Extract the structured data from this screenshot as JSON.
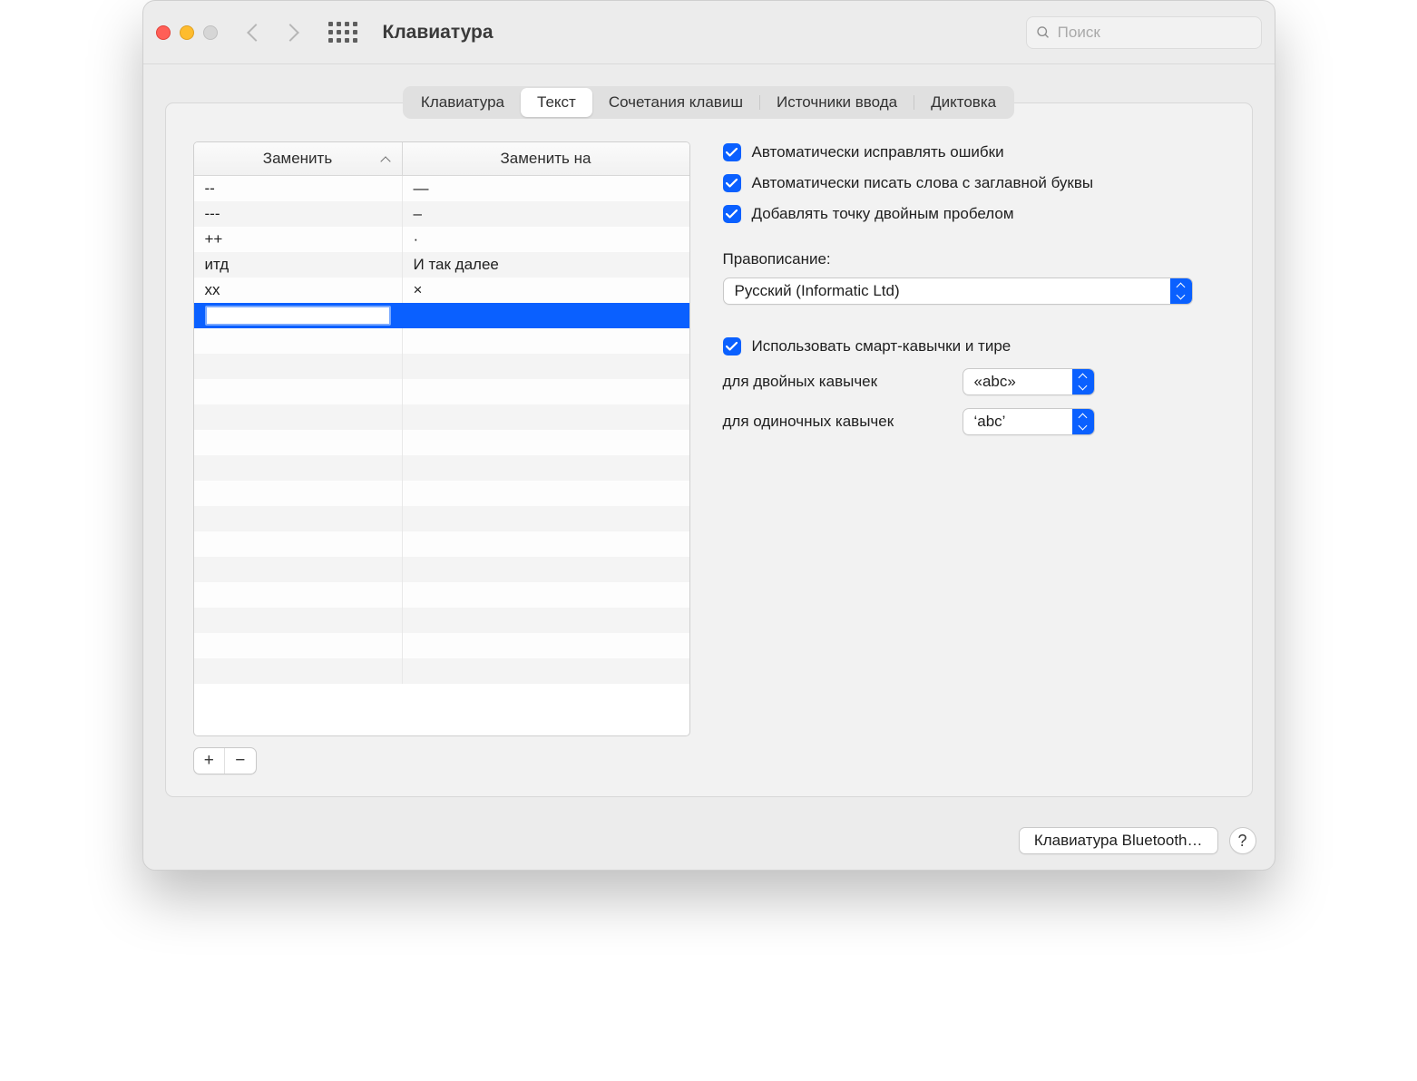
{
  "window": {
    "title": "Клавиатура",
    "search_placeholder": "Поиск"
  },
  "tabs": [
    {
      "label": "Клавиатура",
      "active": false
    },
    {
      "label": "Текст",
      "active": true
    },
    {
      "label": "Сочетания клавиш",
      "active": false
    },
    {
      "label": "Источники ввода",
      "active": false
    },
    {
      "label": "Диктовка",
      "active": false
    }
  ],
  "table": {
    "header_replace": "Заменить",
    "header_with": "Заменить на",
    "rows": [
      {
        "replace": "--",
        "with": "—"
      },
      {
        "replace": "---",
        "with": "–"
      },
      {
        "replace": "++",
        "with": "·"
      },
      {
        "replace": "итд",
        "with": "И так далее"
      },
      {
        "replace": "xx",
        "with": "×"
      }
    ],
    "editing_value": ""
  },
  "controls": {
    "plus": "+",
    "minus": "−"
  },
  "options": {
    "autocorrect": "Автоматически исправлять ошибки",
    "autocapitalize": "Автоматически писать слова с заглавной буквы",
    "double_space_period": "Добавлять точку двойным пробелом",
    "spelling_label": "Правописание:",
    "spelling_value": "Русский (Informatic Ltd)",
    "smart_quotes": "Использовать смарт-кавычки и тире",
    "double_quotes_label": "для двойных кавычек",
    "double_quotes_value": "«abc»",
    "single_quotes_label": "для одиночных кавычек",
    "single_quotes_value": "‘abc’"
  },
  "footer": {
    "bluetooth_button": "Клавиатура Bluetooth…",
    "help": "?"
  }
}
